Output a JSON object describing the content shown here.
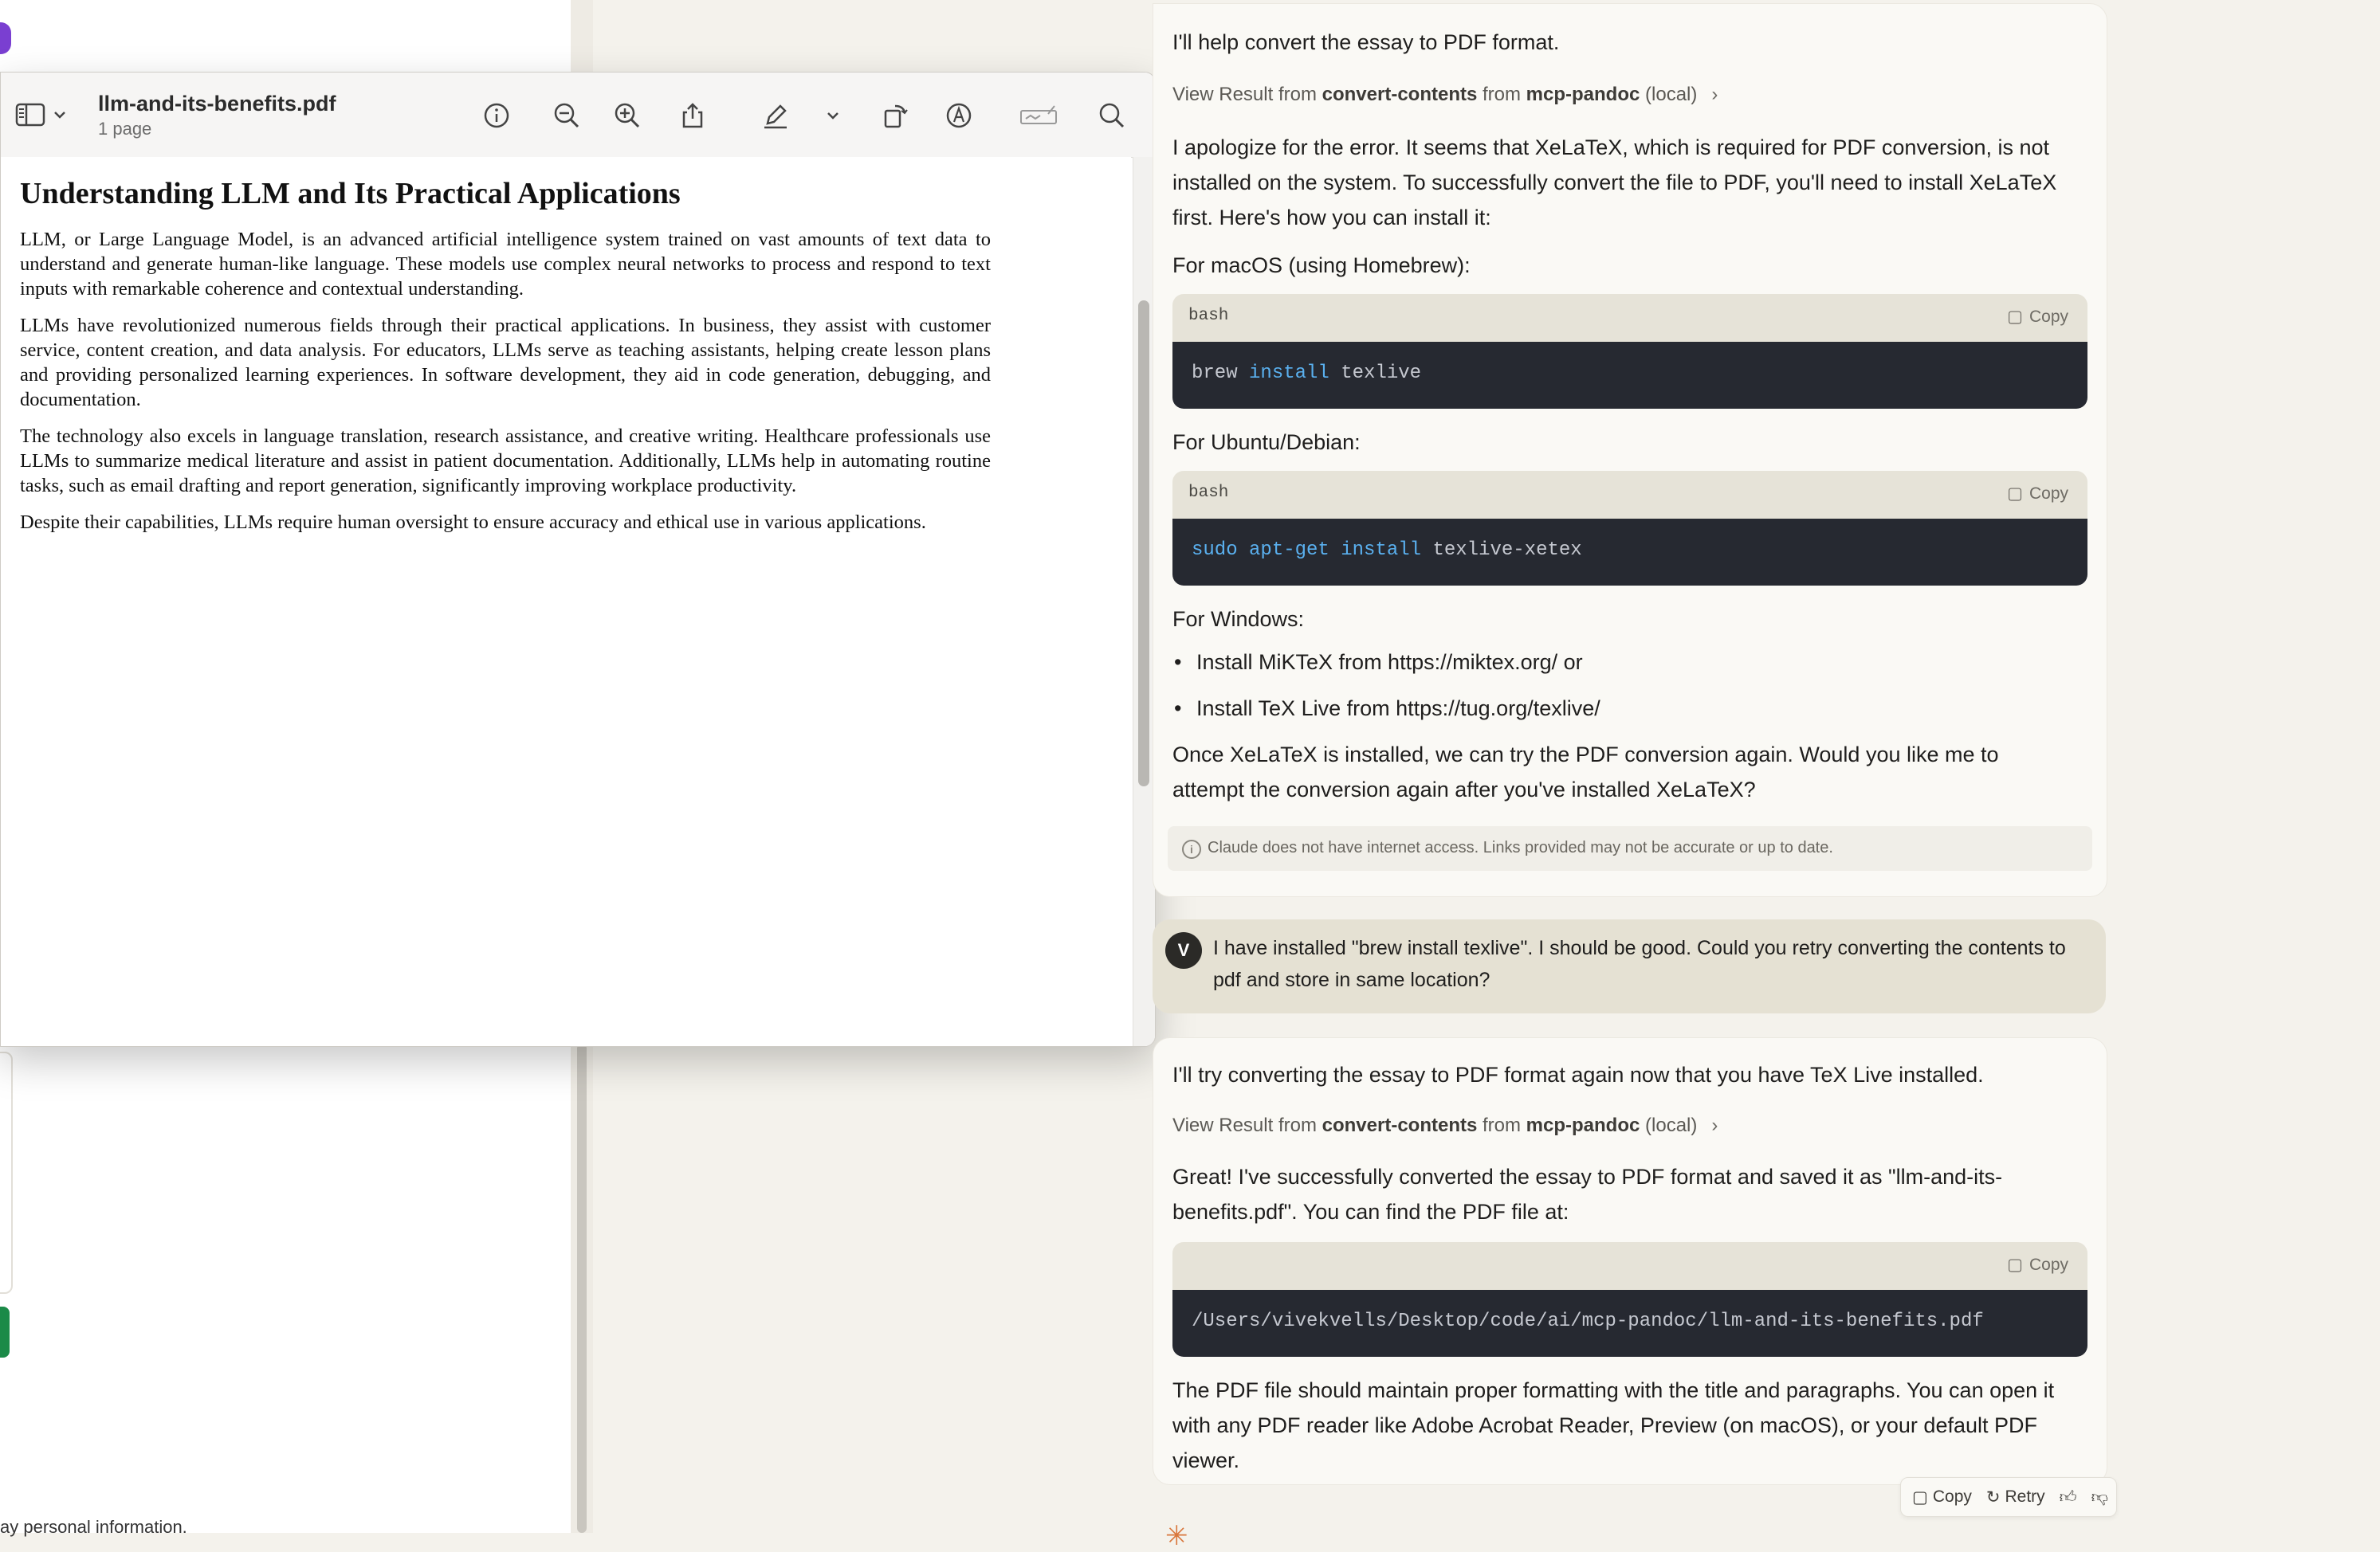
{
  "preview": {
    "filename": "llm-and-its-benefits.pdf",
    "page_count": "1 page",
    "document": {
      "title": "Understanding LLM and Its Practical Applications",
      "paragraphs": [
        "LLM, or Large Language Model, is an advanced artificial intelligence system trained on vast amounts of text data to understand and generate human-like language. These models use complex neural networks to process and respond to text inputs with remarkable coherence and contextual understanding.",
        "LLMs have revolutionized numerous fields through their practical applications. In business, they assist with customer service, content creation, and data analysis. For educators, LLMs serve as teaching assistants, helping create lesson plans and providing personalized learning experiences. In software development, they aid in code generation, debugging, and documentation.",
        "The technology also excels in language translation, research assistance, and creative writing. Healthcare professionals use LLMs to summarize medical literature and assist in patient documentation. Additionally, LLMs help in automating routine tasks, such as email drafting and report generation, significantly improving workplace productivity.",
        "Despite their capabilities, LLMs require human oversight to ensure accuracy and ethical use in various applications."
      ]
    },
    "toolbar_icons": [
      "sidebar-icon",
      "chevron-down-icon",
      "info-icon",
      "zoom-out-icon",
      "zoom-in-icon",
      "share-icon",
      "markup-pen-icon",
      "chevron-down-icon",
      "rotate-icon",
      "annotate-icon",
      "signature-icon",
      "search-icon"
    ]
  },
  "background": {
    "footer_text": "ay personal information."
  },
  "chat": {
    "assistant1": {
      "intro": "I'll help convert the essay to PDF format.",
      "view_result": {
        "prefix": "View Result from ",
        "tool": "convert-contents",
        "mid": " from ",
        "server": "mcp-pandoc",
        "suffix": " (local)",
        "chevron": "›"
      },
      "error_lines": [
        "I apologize for the error. It seems that XeLaTeX, which is required for PDF conversion, is not",
        "installed on the system. To successfully convert the file to PDF, you'll need to install XeLaTeX",
        "first. Here's how you can install it:"
      ],
      "macos_label": "For macOS (using Homebrew):",
      "code1": {
        "lang": "bash",
        "copy": "Copy",
        "cmd": "brew",
        "kw": "install",
        "arg": "texlive"
      },
      "ubuntu_label": "For Ubuntu/Debian:",
      "code2": {
        "lang": "bash",
        "copy": "Copy",
        "cmd": "sudo apt-get install",
        "arg": "texlive-xetex"
      },
      "windows_label": "For Windows:",
      "bullets": [
        "Install MiKTeX from https://miktex.org/ or",
        "Install TeX Live from https://tug.org/texlive/"
      ],
      "closing_lines": [
        "Once XeLaTeX is installed, we can try the PDF conversion again. Would you like me to",
        "attempt the conversion again after you've installed XeLaTeX?"
      ],
      "disclaimer_icon": "i",
      "disclaimer": "Claude does not have internet access. Links provided may not be accurate or up to date."
    },
    "user": {
      "initial": "V",
      "text": "I have installed \"brew install texlive\". I should be good. Could you retry converting the contents to pdf and store in same location?"
    },
    "assistant2": {
      "intro": "I'll try converting the essay to PDF format again now that you have TeX Live installed.",
      "view_result": {
        "prefix": "View Result from ",
        "tool": "convert-contents",
        "mid": " from ",
        "server": "mcp-pandoc",
        "suffix": " (local)",
        "chevron": "›"
      },
      "success_lines": [
        "Great! I've successfully converted the essay to PDF format and saved it as \"llm-and-its-",
        "benefits.pdf\". You can find the PDF file at:"
      ],
      "code3": {
        "copy": "Copy",
        "path": "/Users/vivekvells/Desktop/code/ai/mcp-pandoc/llm-and-its-benefits.pdf"
      },
      "final_lines": [
        "The PDF file should maintain proper formatting with the title and paragraphs. You can open it",
        "with any PDF reader like Adobe Acrobat Reader, Preview (on macOS), or your default PDF",
        "viewer."
      ]
    },
    "actions": {
      "copy": "Copy",
      "retry": "Retry"
    }
  }
}
